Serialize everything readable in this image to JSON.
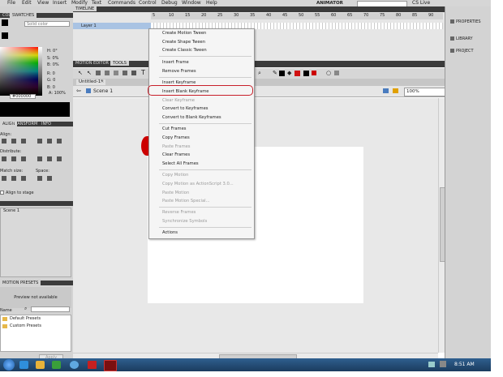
{
  "menubar": {
    "items": [
      "File",
      "Edit",
      "View",
      "Insert",
      "Modify",
      "Text",
      "Commands",
      "Control",
      "Debug",
      "Window",
      "Help"
    ],
    "workspace": "ANIMATOR",
    "cs_live": "CS Live"
  },
  "left_panel": {
    "color_tab": "COLOR",
    "swatches_tab": "SWATCHES",
    "fill_type": "Solid color",
    "hsb": [
      "H: 0°",
      "S: 0%",
      "B: 0%"
    ],
    "rgb": [
      "R: 0",
      "G: 0",
      "B: 0"
    ],
    "alpha": "A: 100%",
    "hex": "#000000",
    "align_tab": "ALIGN",
    "transform_tab": "TRANSFORM",
    "info_tab": "INFO",
    "align_label": "Align:",
    "distribute_label": "Distribute:",
    "match_size_label": "Match size:",
    "space_label": "Space:",
    "align_to_stage": "Align to stage",
    "scene_item": "Scene 1",
    "motion_presets_tab": "MOTION PRESETS",
    "preview_text": "Preview not available",
    "name_label": "Name",
    "default_presets": "Default Presets",
    "custom_presets": "Custom Presets",
    "apply_button": "Apply"
  },
  "timeline": {
    "tab": "TIMELINE",
    "layer_name": "Layer 1",
    "frame_numbers": [
      "5",
      "10",
      "15",
      "20",
      "25",
      "30",
      "35",
      "40",
      "45",
      "50",
      "55",
      "60",
      "65",
      "70",
      "75",
      "80",
      "85",
      "90"
    ]
  },
  "editor": {
    "motion_editor_tab": "MOTION EDITOR",
    "tools_tab": "TOOLS",
    "doc_tab": "Untitled-1*",
    "scene_label": "Scene 1",
    "zoom": "100%"
  },
  "right_panel": {
    "properties": "PROPERTIES",
    "library": "LIBRARY",
    "project": "PROJECT"
  },
  "context_menu": {
    "items": [
      {
        "label": "Create Motion Tween",
        "disabled": false
      },
      {
        "label": "Create Shape Tween",
        "disabled": false
      },
      {
        "label": "Create Classic Tween",
        "disabled": false
      },
      {
        "label": "Insert Frame",
        "disabled": false
      },
      {
        "label": "Remove Frames",
        "disabled": false
      },
      {
        "label": "Insert Keyframe",
        "disabled": false
      },
      {
        "label": "Insert Blank Keyframe",
        "disabled": false
      },
      {
        "label": "Clear Keyframe",
        "disabled": true
      },
      {
        "label": "Convert to Keyframes",
        "disabled": false
      },
      {
        "label": "Convert to Blank Keyframes",
        "disabled": false
      },
      {
        "label": "Cut Frames",
        "disabled": false
      },
      {
        "label": "Copy Frames",
        "disabled": false
      },
      {
        "label": "Paste Frames",
        "disabled": true
      },
      {
        "label": "Clear Frames",
        "disabled": false
      },
      {
        "label": "Select All Frames",
        "disabled": false
      },
      {
        "label": "Copy Motion",
        "disabled": true
      },
      {
        "label": "Copy Motion as ActionScript 3.0...",
        "disabled": true
      },
      {
        "label": "Paste Motion",
        "disabled": true
      },
      {
        "label": "Paste Motion Special...",
        "disabled": true
      },
      {
        "label": "Reverse Frames",
        "disabled": true
      },
      {
        "label": "Synchronize Symbols",
        "disabled": true
      },
      {
        "label": "Actions",
        "disabled": false
      }
    ]
  },
  "taskbar": {
    "time": "8:51 AM"
  },
  "colors": {
    "highlight_ring": "#c8202a",
    "panel_bg": "#d3d3d3",
    "panel_header": "#3b3b3b",
    "taskbar": "#1f4770"
  }
}
